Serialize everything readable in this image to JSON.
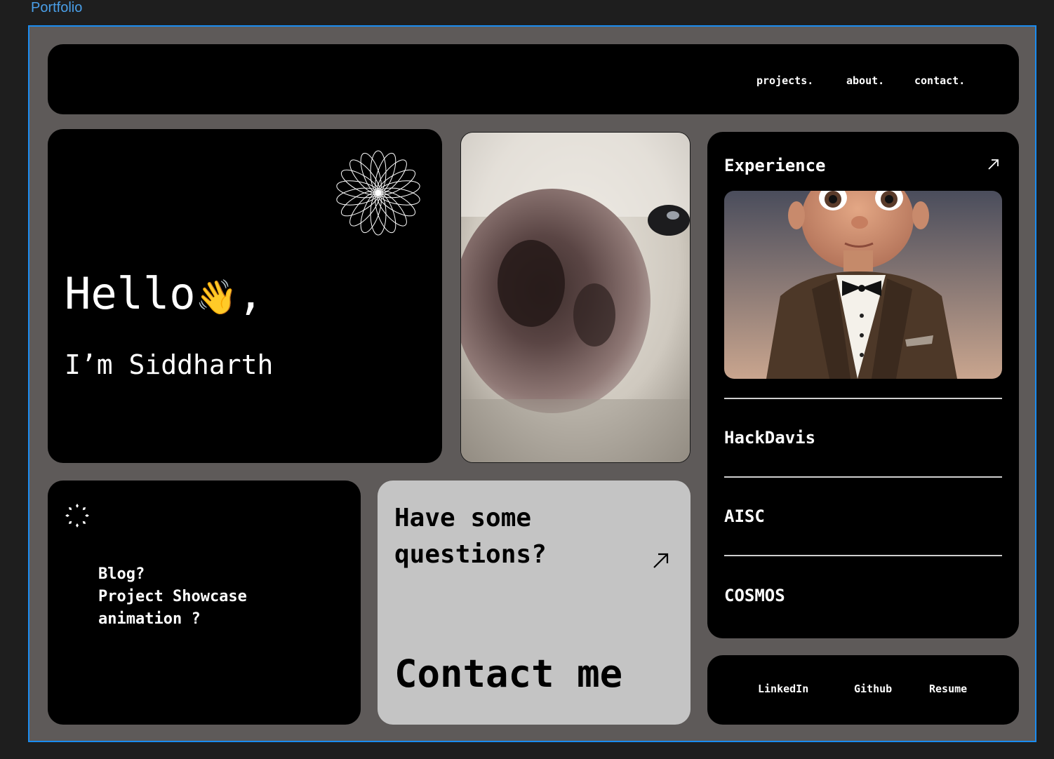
{
  "window": {
    "frame_label": "Portfolio"
  },
  "nav": {
    "projects": "projects.",
    "about": "about.",
    "contact": "contact."
  },
  "hero": {
    "greeting": "Hello",
    "wave": "👋",
    "comma": ",",
    "intro": "I’m Siddharth"
  },
  "experience": {
    "title": "Experience",
    "items": [
      "HackDavis",
      "AISC",
      "COSMOS"
    ]
  },
  "blog": {
    "lines": [
      "Blog?",
      "Project Showcase",
      "animation ?"
    ]
  },
  "contact_card": {
    "question_line1": "Have some",
    "question_line2": "questions?",
    "cta": "Contact me"
  },
  "social": {
    "linkedin": "LinkedIn",
    "github": "Github",
    "resume": "Resume"
  },
  "icons": {
    "flower": "flower-icon",
    "sparkle": "sparkle-ring-icon",
    "arrow": "arrow-up-right-icon"
  },
  "colors": {
    "frame_border": "#1b8cf0",
    "frame_bg": "#5e5a59",
    "card_bg": "#000000",
    "contact_bg": "#c4c4c4",
    "label": "#4a9fe8"
  }
}
